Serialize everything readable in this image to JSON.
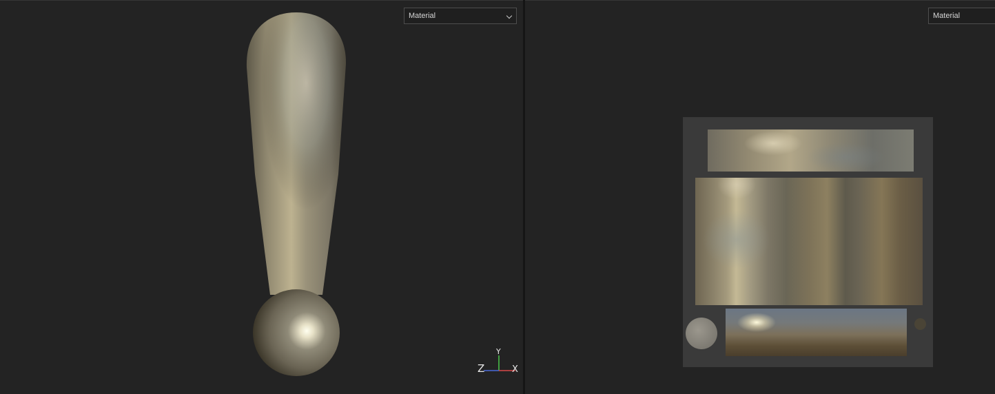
{
  "left_viewport": {
    "dropdown": {
      "selected": "Material",
      "icon": "chevron-down-icon"
    },
    "axis_gizmo": {
      "x_label": "X",
      "y_label": "Y",
      "z_label": "Z",
      "colors": {
        "x": "#d94a4a",
        "y": "#4ac84a",
        "z": "#4a6ad9"
      }
    }
  },
  "right_viewport": {
    "dropdown": {
      "selected": "Material",
      "icon": "chevron-down-icon"
    }
  },
  "colors": {
    "background": "#232323",
    "panel": "#3a3a3a",
    "divider": "#151515"
  }
}
